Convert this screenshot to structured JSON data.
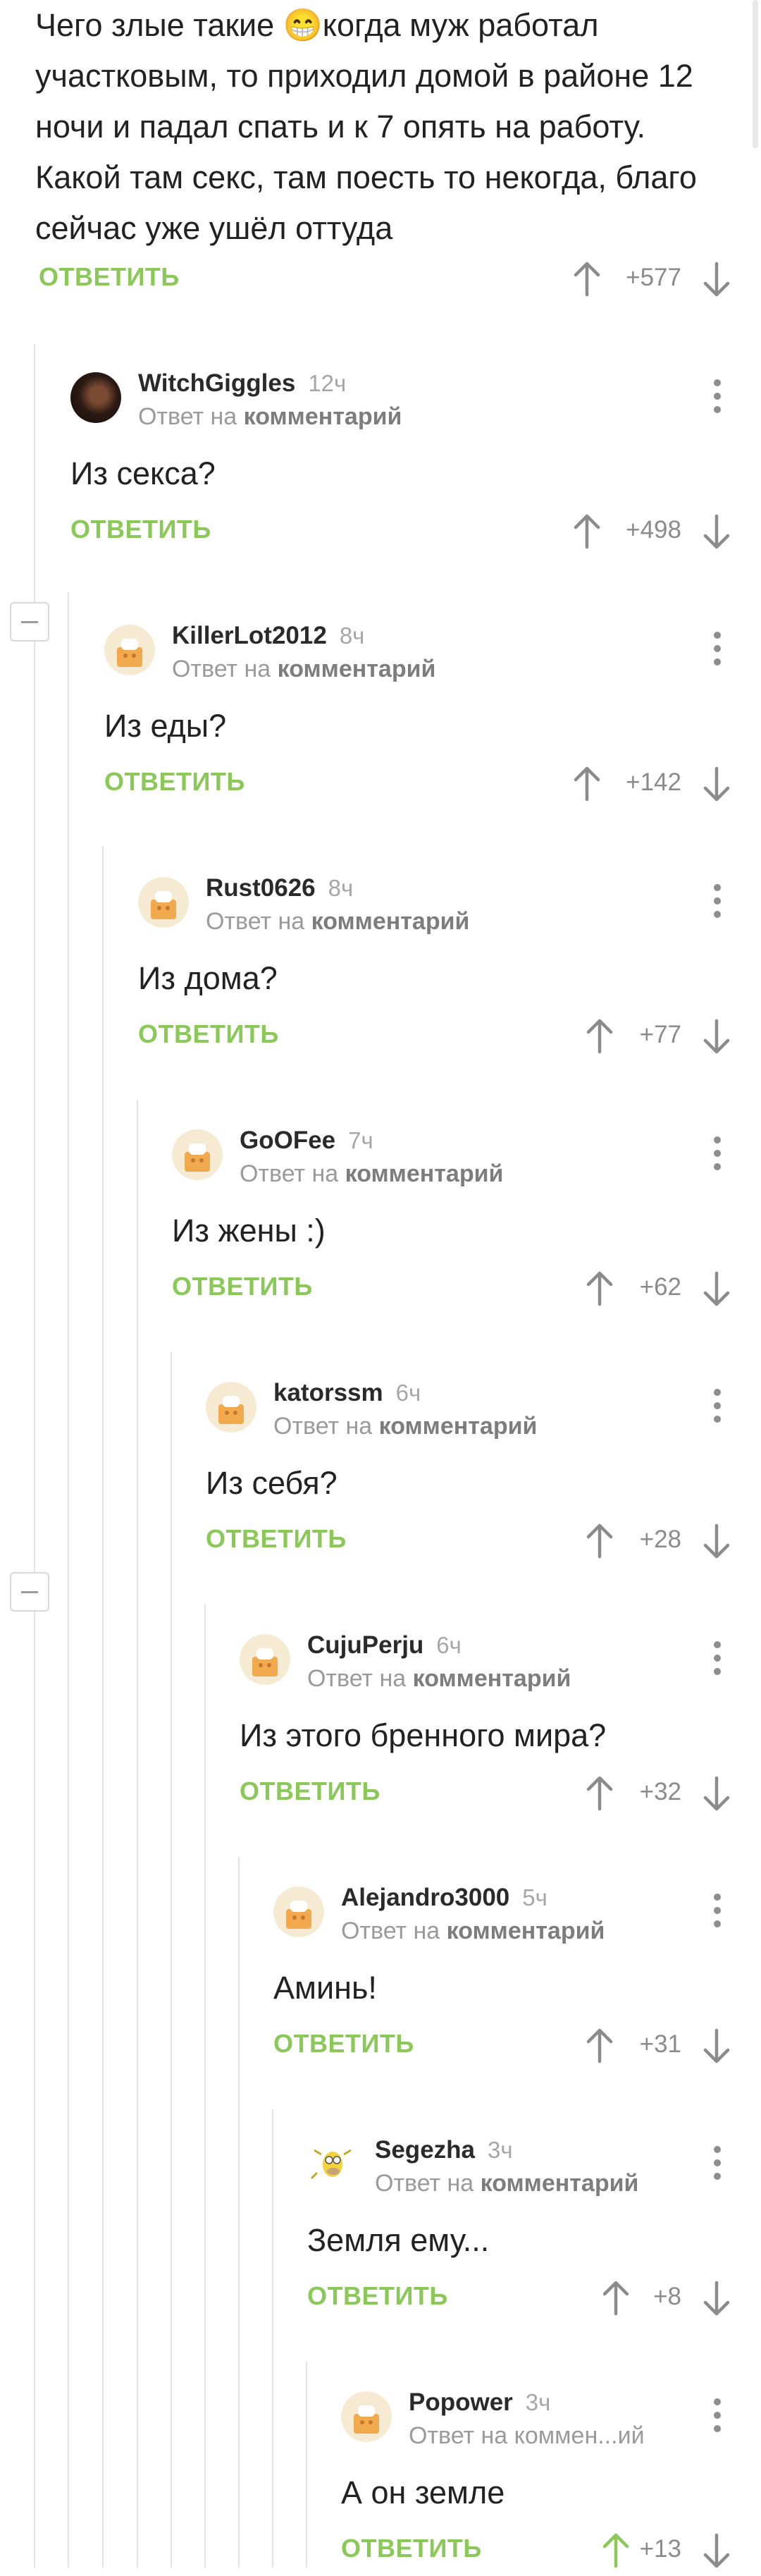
{
  "top_comment": {
    "text": "Чего злые такие 😁когда муж работал участковым, то приходил домой в районе 12 ночи и падал спать и к 7 опять на работу. Какой там секс, там поесть то некогда, благо сейчас уже ушёл оттуда",
    "reply_label": "ОТВЕТИТЬ",
    "score": "+577"
  },
  "reply_to_prefix": "Ответ на",
  "reply_to_target": "комментарий",
  "reply_label": "ОТВЕТИТЬ",
  "comments": [
    {
      "author": "WitchGiggles",
      "age": "12ч",
      "text": "Из секса?",
      "score": "+498"
    },
    {
      "author": "KillerLot2012",
      "age": "8ч",
      "text": "Из еды?",
      "score": "+142"
    },
    {
      "author": "Rust0626",
      "age": "8ч",
      "text": "Из дома?",
      "score": "+77"
    },
    {
      "author": "GoOFee",
      "age": "7ч",
      "text": "Из жены :)",
      "score": "+62"
    },
    {
      "author": "katorssm",
      "age": "6ч",
      "text": "Из себя?",
      "score": "+28"
    },
    {
      "author": "CujuPerju",
      "age": "6ч",
      "text": "Из этого бренного мира?",
      "score": "+32"
    },
    {
      "author": "Alejandro3000",
      "age": "5ч",
      "text": "Аминь!",
      "score": "+31"
    },
    {
      "author": "Segezha",
      "age": "3ч",
      "text": "Земля ему...",
      "score": "+8"
    },
    {
      "author": "Popower",
      "age": "3ч",
      "text": "А он земле",
      "score": "+13",
      "reply_to_truncated": "Ответ на коммен...ий",
      "upvoted": true
    }
  ],
  "colors": {
    "accent_green": "#8ac858",
    "muted": "#9a9a9a",
    "line": "#e3e3e3"
  }
}
